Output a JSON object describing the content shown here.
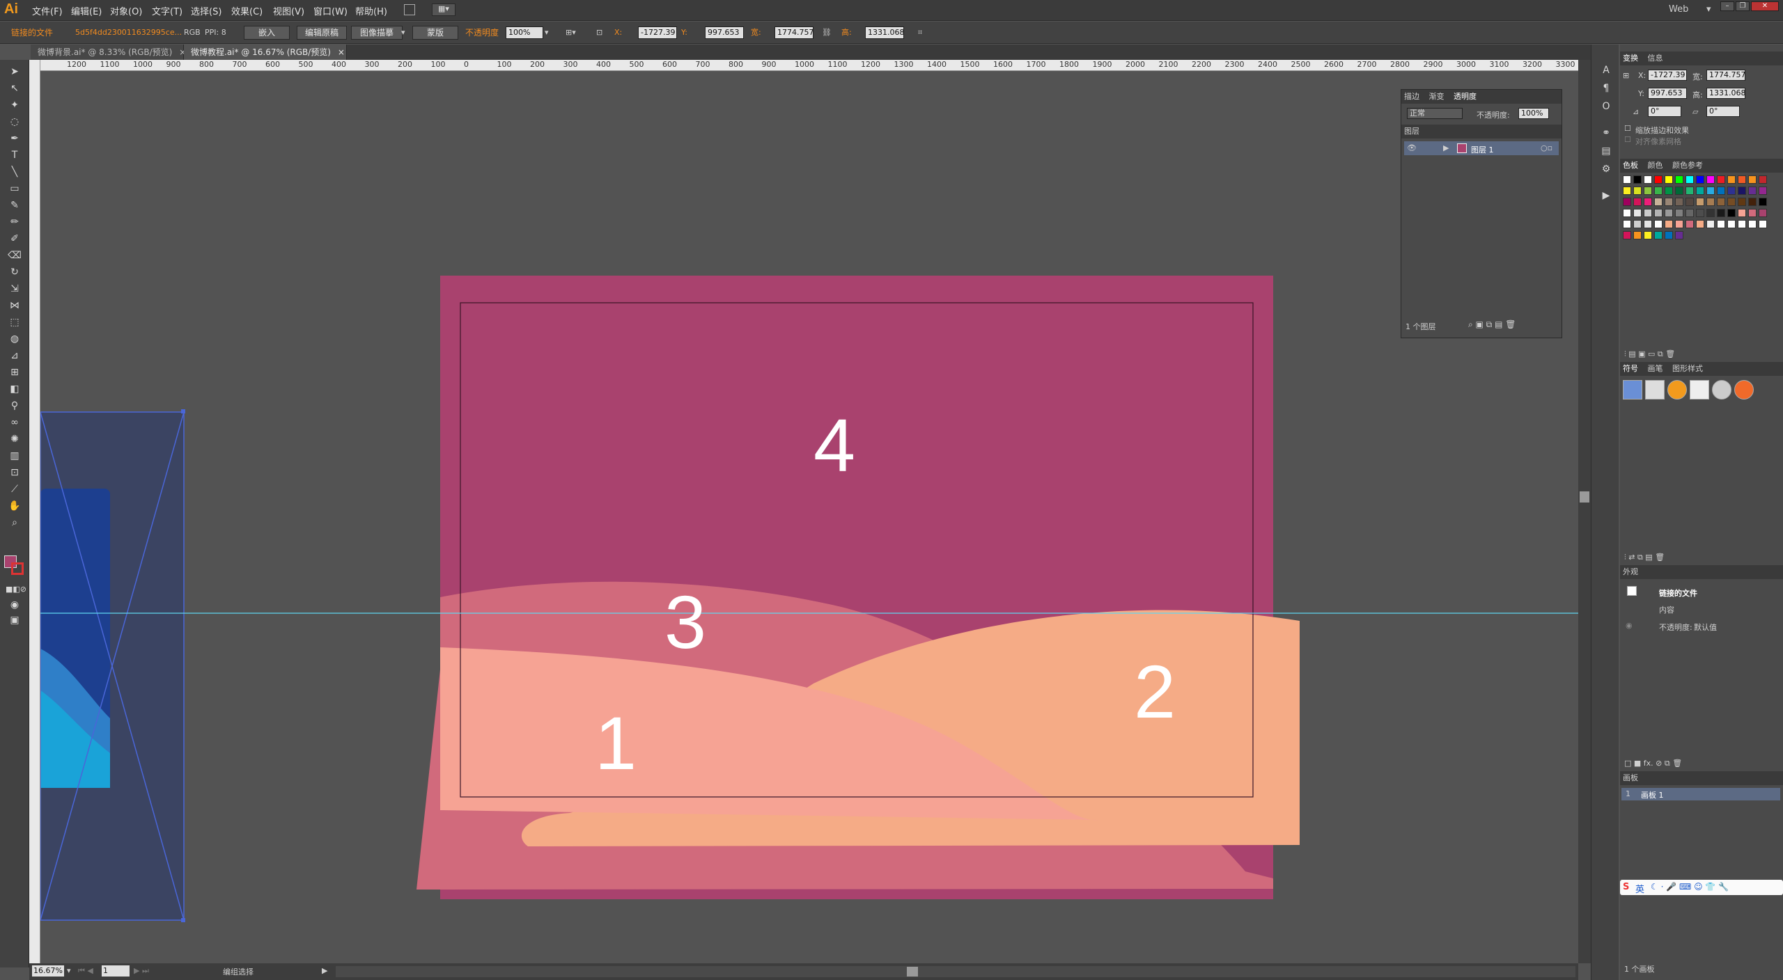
{
  "app": {
    "logo": "Ai",
    "workspace": "Web"
  },
  "menu": [
    "文件(F)",
    "编辑(E)",
    "对象(O)",
    "文字(T)",
    "选择(S)",
    "效果(C)",
    "视图(V)",
    "窗口(W)",
    "帮助(H)"
  ],
  "control": {
    "linked_label": "链接的文件",
    "filename": "5d5f4dd230011632995ce...",
    "color_mode": "RGB",
    "ppi_label": "PPI: 8",
    "embed_btn": "嵌入",
    "edit_original_btn": "编辑原稿",
    "trace_btn": "图像描摹",
    "mask_btn": "蒙版",
    "opacity_label": "不透明度",
    "opacity_value": "100%",
    "x_label": "X:",
    "x_value": "-1727.39",
    "y_label": "Y:",
    "y_value": "997.653",
    "w_label": "宽:",
    "w_value": "1774.757",
    "h_label": "高:",
    "h_value": "1331.068"
  },
  "tabs": [
    {
      "label": "微博背景.ai* @ 8.33% (RGB/预览)",
      "close": "×"
    },
    {
      "label": "微博教程.ai* @ 16.67% (RGB/预览)",
      "close": "×"
    }
  ],
  "ruler": {
    "h_ticks": [
      "1200",
      "1100",
      "1000",
      "900",
      "800",
      "700",
      "600",
      "500",
      "400",
      "300",
      "200",
      "100",
      "0",
      "100",
      "200",
      "300",
      "400",
      "500",
      "600",
      "700",
      "800",
      "900",
      "1000",
      "1100",
      "1200",
      "1300",
      "1400",
      "1500",
      "1600",
      "1700",
      "1800",
      "1900",
      "2000",
      "2100",
      "2200",
      "2300",
      "2400",
      "2500",
      "2600",
      "2700",
      "2800",
      "2900",
      "3000",
      "3100",
      "3200",
      "3300"
    ]
  },
  "artwork": {
    "labels": [
      "4",
      "3",
      "2",
      "1"
    ],
    "colors": {
      "bg": "#a9426e",
      "mid": "#d16a7c",
      "peach": "#f5ab86",
      "pink": "#f6a394",
      "selection": "#4a66d8",
      "guide": "#5fd6f0"
    }
  },
  "layers_panel": {
    "tabs": [
      "描边",
      "渐变",
      "透明度"
    ],
    "blend_mode": "正常",
    "opacity_label": "不透明度:",
    "opacity_value": "100%",
    "title": "图层",
    "layer_name": "图层 1",
    "footer": "1 个图层"
  },
  "transform_panel": {
    "tabs": [
      "变换",
      "信息"
    ],
    "x_label": "X:",
    "x": "-1727.39",
    "w_label": "宽:",
    "w": "1774.757",
    "y_label": "Y:",
    "y": "997.653",
    "h_label": "高:",
    "h": "1331.068",
    "angle1": "0°",
    "angle2": "0°",
    "scale_strokes": "缩放描边和效果",
    "align_pixel": "对齐像素网格"
  },
  "swatches_panel": {
    "tabs": [
      "色板",
      "颜色",
      "颜色参考"
    ]
  },
  "symbols_panel": {
    "tabs": [
      "符号",
      "画笔",
      "图形样式"
    ]
  },
  "appearance_panel": {
    "title": "外观",
    "item": "链接的文件",
    "content": "内容",
    "opacity_label": "不透明度:",
    "opacity_value": "默认值"
  },
  "artboards_panel": {
    "title": "画板",
    "row_num": "1",
    "row_name": "画板 1",
    "footer": "1 个画板"
  },
  "status": {
    "zoom": "16.67%",
    "page": "1",
    "tool": "编组选择"
  },
  "ime": {
    "label": "英"
  }
}
